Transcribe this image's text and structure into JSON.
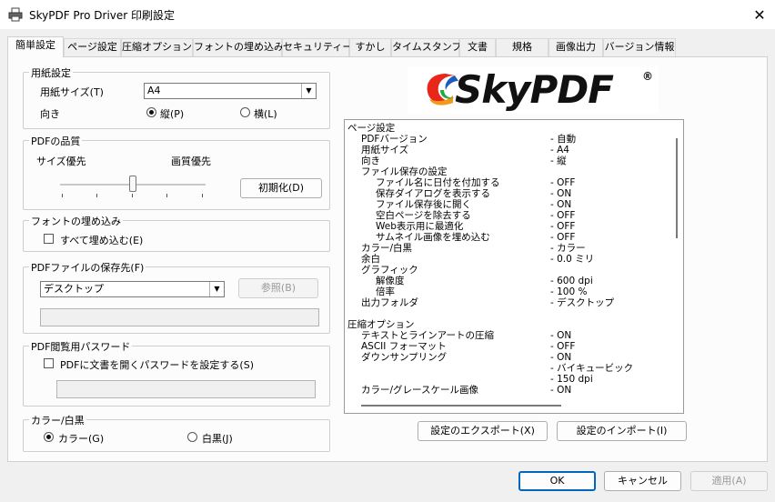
{
  "window": {
    "title": "SkyPDF Pro Driver 印刷設定",
    "close": "✕"
  },
  "tabs": [
    "簡単設定",
    "ページ設定",
    "圧縮オプション",
    "フォントの埋め込み",
    "セキュリティー",
    "すかし",
    "タイムスタンプ",
    "文書",
    "規格",
    "画像出力",
    "バージョン情報"
  ],
  "paper": {
    "legend": "用紙設定",
    "size_label": "用紙サイズ(T)",
    "size_value": "A4",
    "orientation_label": "向き",
    "portrait": "縦(P)",
    "landscape": "横(L)",
    "selected": "portrait"
  },
  "quality": {
    "legend": "PDFの品質",
    "size_priority": "サイズ優先",
    "quality_priority": "画質優先",
    "slider_fraction": 0.5,
    "reset": "初期化(D)"
  },
  "fonts": {
    "legend": "フォントの埋め込み",
    "embed_all": "すべて埋め込む(E)",
    "checked": false
  },
  "save": {
    "legend": "PDFファイルの保存先(F)",
    "location": "デスクトップ",
    "browse": "参照(B)",
    "path": ""
  },
  "password": {
    "legend": "PDF閲覧用パスワード",
    "check_label": "PDFに文書を開くパスワードを設定する(S)",
    "checked": false,
    "value": ""
  },
  "color": {
    "legend": "カラー/白黒",
    "color": "カラー(G)",
    "mono": "白黒(J)",
    "selected": "color"
  },
  "logo": {
    "text": "SkyPDF",
    "mark": "®"
  },
  "summary": [
    {
      "k": "ページ設定",
      "v": "",
      "i": 0
    },
    {
      "k": "PDFバージョン",
      "v": "- 自動",
      "i": 1
    },
    {
      "k": "用紙サイズ",
      "v": "- A4",
      "i": 1
    },
    {
      "k": "向き",
      "v": "- 縦",
      "i": 1
    },
    {
      "k": "ファイル保存の設定",
      "v": "",
      "i": 1
    },
    {
      "k": "ファイル名に日付を付加する",
      "v": "- OFF",
      "i": 2
    },
    {
      "k": "保存ダイアログを表示する",
      "v": "- ON",
      "i": 2
    },
    {
      "k": "ファイル保存後に開く",
      "v": "- ON",
      "i": 2
    },
    {
      "k": "空白ページを除去する",
      "v": "- OFF",
      "i": 2
    },
    {
      "k": "Web表示用に最適化",
      "v": "- OFF",
      "i": 2
    },
    {
      "k": "サムネイル画像を埋め込む",
      "v": "- OFF",
      "i": 2
    },
    {
      "k": "カラー/白黒",
      "v": "- カラー",
      "i": 1
    },
    {
      "k": "余白",
      "v": "- 0.0 ミリ",
      "i": 1
    },
    {
      "k": "グラフィック",
      "v": "",
      "i": 1
    },
    {
      "k": "解像度",
      "v": "- 600 dpi",
      "i": 2
    },
    {
      "k": "倍率",
      "v": "- 100 %",
      "i": 2
    },
    {
      "k": "出力フォルダ",
      "v": "- デスクトップ",
      "i": 1
    },
    {
      "k": "",
      "v": "",
      "i": 0
    },
    {
      "k": "圧縮オプション",
      "v": "",
      "i": 0
    },
    {
      "k": "テキストとラインアートの圧縮",
      "v": "- ON",
      "i": 1
    },
    {
      "k": "ASCII フォーマット",
      "v": "- OFF",
      "i": 1
    },
    {
      "k": "ダウンサンプリング",
      "v": "- ON",
      "i": 1
    },
    {
      "k": "",
      "v": "- バイキュービック",
      "i": 1
    },
    {
      "k": "",
      "v": "- 150 dpi",
      "i": 1
    },
    {
      "k": "カラー/グレースケール画像",
      "v": "- ON",
      "i": 1
    }
  ],
  "export": "設定のエクスポート(X)",
  "import": "設定のインポート(I)",
  "footer": {
    "ok": "OK",
    "cancel": "キャンセル",
    "apply": "適用(A)"
  }
}
